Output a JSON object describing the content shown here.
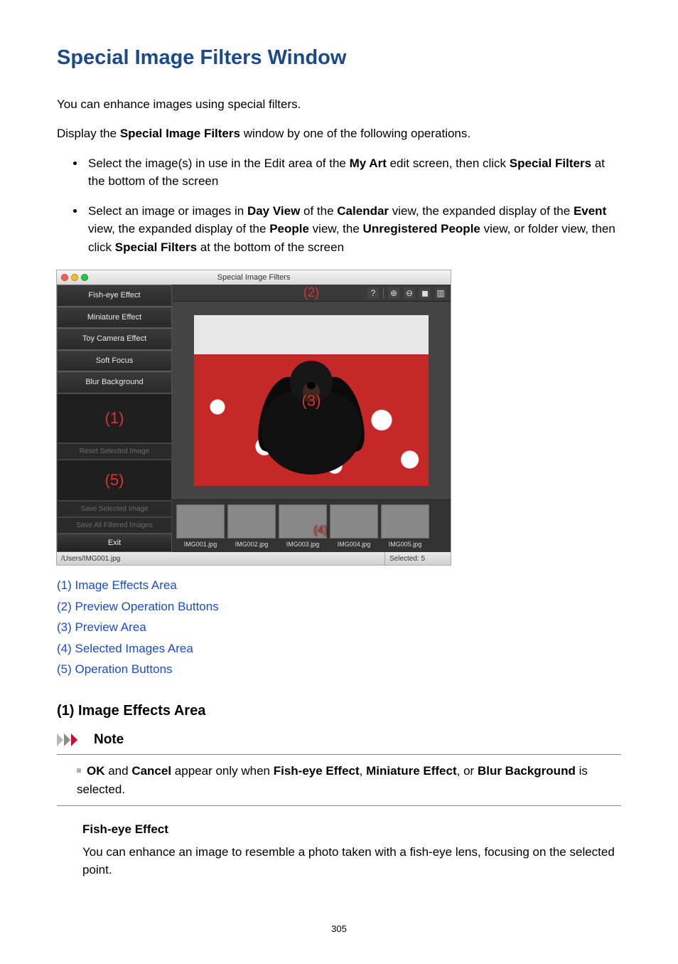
{
  "heading": "Special Image Filters Window",
  "intro_p1": "You can enhance images using special filters.",
  "intro_p2_a": "Display the ",
  "intro_p2_b": "Special Image Filters",
  "intro_p2_c": " window by one of the following operations.",
  "bullets": {
    "0": {
      "a": "Select the image(s) in use in the Edit area of the ",
      "b": "My Art",
      "c": " edit screen, then click ",
      "d": "Special Filters",
      "e": " at the bottom of the screen"
    },
    "1": {
      "a": "Select an image or images in ",
      "b": "Day View",
      "c": " of the ",
      "d": "Calendar",
      "e": " view, the expanded display of the ",
      "f": "Event",
      "g": " view, the expanded display of the ",
      "h": "People",
      "i": " view, the ",
      "j": "Unregistered People",
      "k": " view, or folder view, then click ",
      "l": "Special Filters",
      "m": " at the bottom of the screen"
    }
  },
  "screenshot": {
    "title": "Special Image Filters",
    "filters": {
      "0": "Fish-eye Effect",
      "1": "Miniature Effect",
      "2": "Toy Camera Effect",
      "3": "Soft Focus",
      "4": "Blur Background"
    },
    "reset": "Reset Selected Image",
    "save_selected": "Save Selected Image",
    "save_all": "Save All Filtered Images",
    "exit": "Exit",
    "num1": "(1)",
    "num2": "(2)",
    "num3": "(3)",
    "num4": "(4)",
    "num5": "(5)",
    "thumbs": {
      "0": "IMG001.jpg",
      "1": "IMG002.jpg",
      "2": "IMG003.jpg",
      "3": "IMG004.jpg",
      "4": "IMG005.jpg"
    },
    "status_path": "/Users/IMG001.jpg",
    "status_selected": "Selected: 5",
    "icons": {
      "help": "?",
      "plus": "⊕",
      "minus": "⊖",
      "fit": "◼",
      "dual": "▥"
    }
  },
  "links": {
    "0": "(1) Image Effects Area",
    "1": "(2) Preview Operation Buttons",
    "2": "(3) Preview Area",
    "3": "(4) Selected Images Area",
    "4": "(5) Operation Buttons"
  },
  "section1": {
    "heading": "(1) Image Effects Area",
    "note_label": "Note",
    "note": {
      "a": "OK",
      "b": " and ",
      "c": "Cancel",
      "d": " appear only when ",
      "e": "Fish-eye Effect",
      "f": ", ",
      "g": "Miniature Effect",
      "h": ", or ",
      "i": "Blur Background",
      "j": " is selected."
    },
    "item1_title": "Fish-eye Effect",
    "item1_body": "You can enhance an image to resemble a photo taken with a fish-eye lens, focusing on the selected point."
  },
  "page_number": "305"
}
